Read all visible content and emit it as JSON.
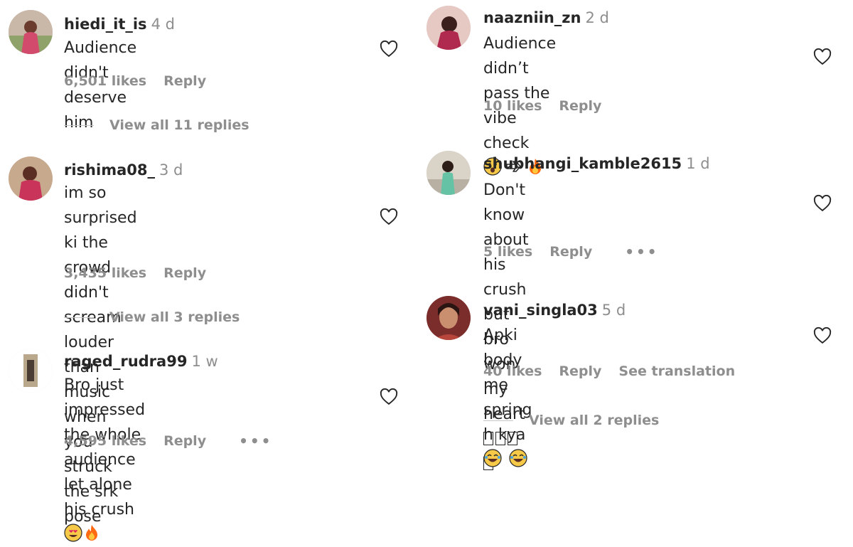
{
  "left_comments": [
    {
      "username": "hiedi_it_is",
      "time": "4 d",
      "text_lines": [
        "Audience didn't deserve him"
      ],
      "likes": "6,501 likes",
      "reply_label": "Reply",
      "view_replies": "View all 11 replies",
      "avatar_icon": "profile-photo"
    },
    {
      "username": "rishima08_",
      "time": "3 d",
      "text_lines": [
        "im so surprised ki the crowd didn't",
        "scream louder than music when",
        "you struck the srk pose"
      ],
      "likes": "3,435 likes",
      "reply_label": "Reply",
      "view_replies": "View all 3 replies",
      "avatar_icon": "profile-photo"
    },
    {
      "username": "raged_rudra99",
      "time": "1 w",
      "text_lines": [
        "Bro just impressed the whole",
        "audience let alone his crush"
      ],
      "likes": "4,595 likes",
      "reply_label": "Reply",
      "more": "•••",
      "avatar_icon": "profile-photo"
    }
  ],
  "right_comments": [
    {
      "username": "naazniin_zn",
      "time": "2 d",
      "text_lines": [
        "Audience didn’t pass the vibe check"
      ],
      "likes": "10 likes",
      "reply_label": "Reply",
      "avatar_icon": "profile-photo"
    },
    {
      "username": "shubhangi_kamble2615",
      "time": "1 d",
      "text_lines": [
        "Don't know about his crush but bro",
        "won my heart "
      ],
      "likes": "5 likes",
      "reply_label": "Reply",
      "more": "•••",
      "avatar_icon": "profile-photo"
    },
    {
      "username": "vani_singla03",
      "time": "5 d",
      "text_lines": [
        "Apki body me spring h kya"
      ],
      "likes": "40 likes",
      "reply_label": "Reply",
      "see_translation": "See translation",
      "view_replies": "View all 2 replies",
      "avatar_icon": "profile-photo"
    }
  ],
  "icons": {
    "like": "heart-outline-icon"
  },
  "colors": {
    "text": "#262626",
    "secondary": "#8e8e8e",
    "divider": "#c7c7c7"
  }
}
